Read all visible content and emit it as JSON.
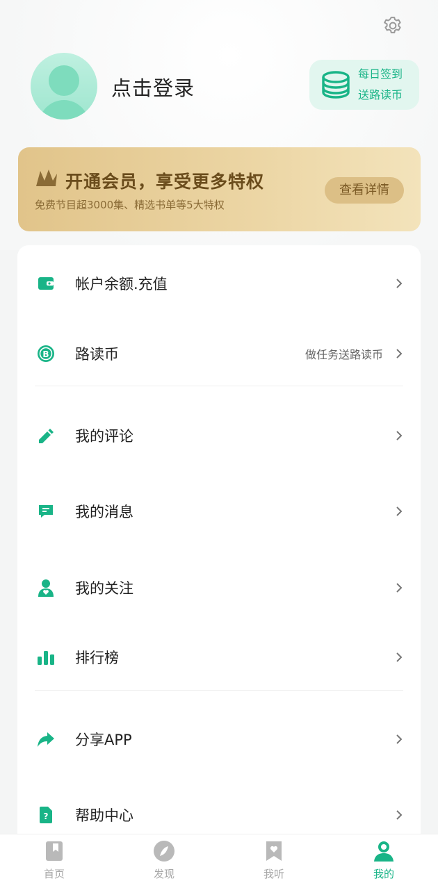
{
  "header": {
    "login_text": "点击登录",
    "checkin_line1": "每日签到",
    "checkin_line2": "送路读币"
  },
  "vip": {
    "title": "开通会员，享受更多特权",
    "subtitle": "免费节目超3000集、精选书单等5大特权",
    "detail_button": "查看详情"
  },
  "menu": [
    {
      "label": "帐户余额.充值",
      "icon": "wallet-icon",
      "hint": ""
    },
    {
      "label": "路读币",
      "icon": "coin-b-icon",
      "hint": "做任务送路读币"
    },
    {
      "label": "我的评论",
      "icon": "pencil-icon",
      "hint": ""
    },
    {
      "label": "我的消息",
      "icon": "message-icon",
      "hint": ""
    },
    {
      "label": "我的关注",
      "icon": "person-heart-icon",
      "hint": ""
    },
    {
      "label": "排行榜",
      "icon": "bar-chart-icon",
      "hint": ""
    },
    {
      "label": "分享APP",
      "icon": "share-arrow-icon",
      "hint": ""
    },
    {
      "label": "帮助中心",
      "icon": "help-doc-icon",
      "hint": ""
    }
  ],
  "tabs": [
    {
      "label": "首页",
      "icon": "bookmark-icon",
      "active": false
    },
    {
      "label": "发现",
      "icon": "compass-icon",
      "active": false
    },
    {
      "label": "我听",
      "icon": "heart-bookmark-icon",
      "active": false
    },
    {
      "label": "我的",
      "icon": "profile-icon",
      "active": true
    }
  ],
  "colors": {
    "accent": "#19b487",
    "gold": "#e1c48a",
    "text": "#222222",
    "muted": "#a7a7a7"
  }
}
